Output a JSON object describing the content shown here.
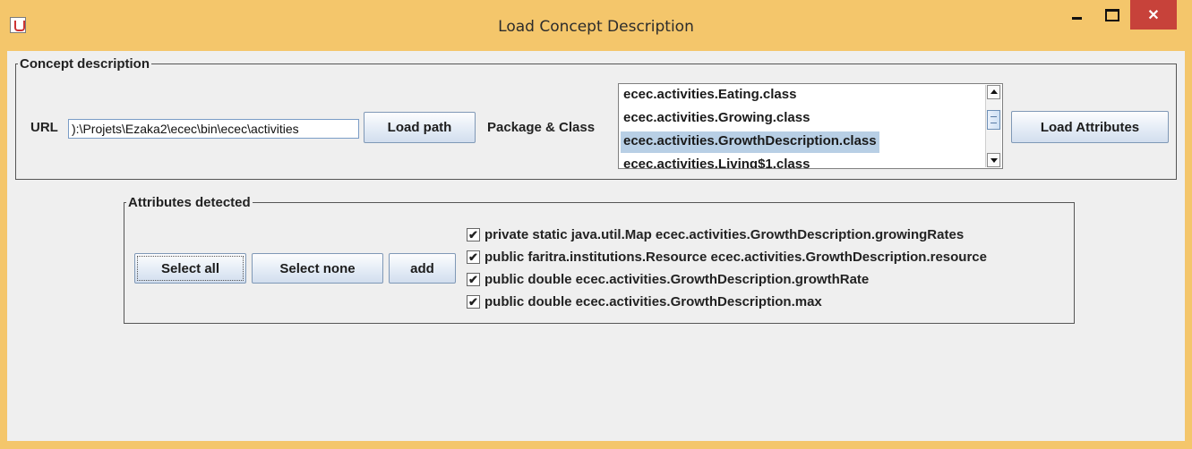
{
  "window": {
    "title": "Load Concept Description",
    "close_glyph": "✕"
  },
  "concept": {
    "legend": "Concept description",
    "url_label": "URL",
    "url_value": "):\\Projets\\Ezaka2\\ecec\\bin\\ecec\\activities",
    "load_path_label": "Load path",
    "package_class_label": "Package & Class",
    "classes": [
      {
        "label": "ecec.activities.Eating.class",
        "selected": false
      },
      {
        "label": "ecec.activities.Growing.class",
        "selected": false
      },
      {
        "label": "ecec.activities.GrowthDescription.class",
        "selected": true
      },
      {
        "label": "ecec.activities.Living$1.class",
        "selected": false
      }
    ],
    "load_attributes_label": "Load Attributes"
  },
  "attributes": {
    "legend": "Attributes detected",
    "select_all_label": "Select all",
    "select_none_label": "Select none",
    "add_label": "add",
    "items": [
      {
        "label": "private static java.util.Map ecec.activities.GrowthDescription.growingRates",
        "checked": true
      },
      {
        "label": "public faritra.institutions.Resource ecec.activities.GrowthDescription.resource",
        "checked": true
      },
      {
        "label": "public double ecec.activities.GrowthDescription.growthRate",
        "checked": true
      },
      {
        "label": "public double ecec.activities.GrowthDescription.max",
        "checked": true
      }
    ],
    "check_glyph": "✔"
  },
  "colors": {
    "title_bar": "#f4c66b",
    "close_button": "#c7423a",
    "selection": "#b8cfe5"
  }
}
